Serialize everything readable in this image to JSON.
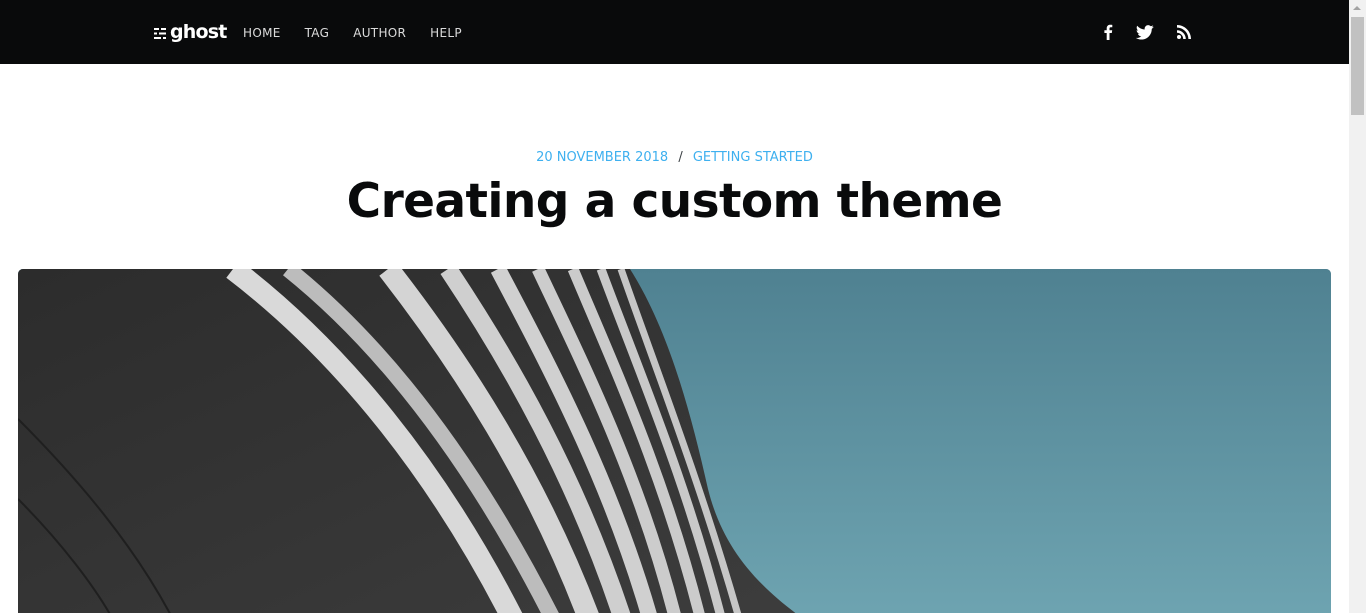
{
  "nav": {
    "logo_text": "ghost",
    "links": [
      {
        "label": "HOME"
      },
      {
        "label": "TAG"
      },
      {
        "label": "AUTHOR"
      },
      {
        "label": "HELP"
      }
    ],
    "social": [
      {
        "icon": "facebook-icon"
      },
      {
        "icon": "twitter-icon"
      },
      {
        "icon": "rss-icon"
      }
    ],
    "background": "#090a0b"
  },
  "post": {
    "date": "20 November 2018",
    "divider": "/",
    "tag": "Getting Started",
    "title": "Creating a custom theme",
    "accent_color": "#3eb0ef",
    "feature_image": {
      "subject": "building-facade-sky-image",
      "sky_color": "#5b8d9b"
    }
  },
  "colors": {
    "text_dark": "#090a0b",
    "accent": "#3eb0ef",
    "page_background": "#ffffff"
  }
}
